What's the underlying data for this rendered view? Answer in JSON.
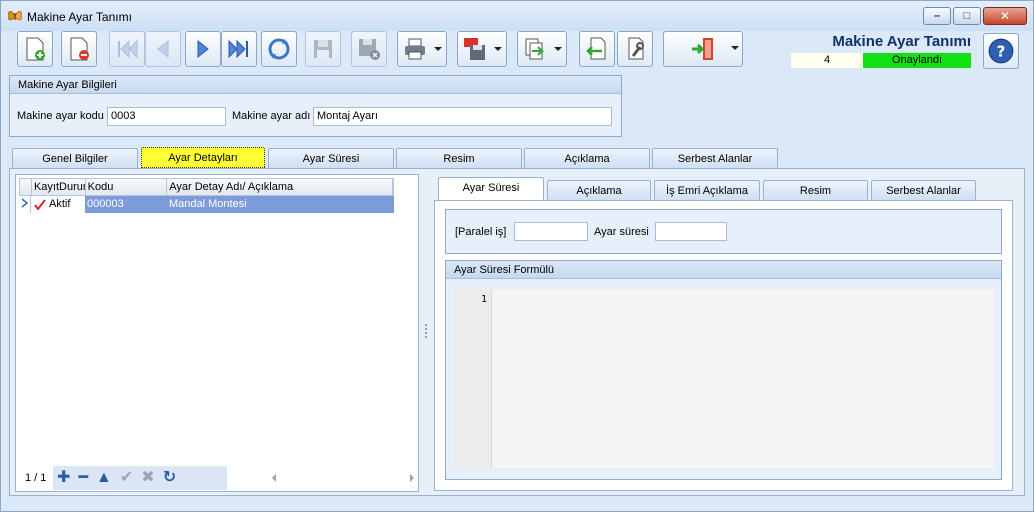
{
  "window": {
    "title": "Makine Ayar Tanımı",
    "controls": {
      "minimize": "–",
      "maximize": "□",
      "close": "✕"
    }
  },
  "header": {
    "form_title": "Makine Ayar Tanımı",
    "record_no": "4",
    "status": "Onaylandı",
    "status_color": "#12e012"
  },
  "toolbar": {
    "icons": [
      "new-document-icon",
      "delete-document-icon",
      "first-record-icon",
      "previous-record-icon",
      "next-record-icon",
      "last-record-icon",
      "refresh-icon",
      "save-icon",
      "save-cancel-icon",
      "print-icon",
      "pdf-export-icon",
      "export-icon",
      "import-icon",
      "settings-tool-icon",
      "exit-door-icon",
      "help-icon"
    ]
  },
  "info_group": {
    "title": "Makine Ayar Bilgileri",
    "code_label": "Makine ayar kodu",
    "code_value": "0003",
    "name_label": "Makine ayar adı",
    "name_value": "Montaj Ayarı"
  },
  "main_tabs": [
    "Genel Bilgiler",
    "Ayar Detayları",
    "Ayar Süresi",
    "Resim",
    "Açıklama",
    "Serbest Alanlar"
  ],
  "detail_grid": {
    "columns": [
      "KayıtDurumu",
      "Kodu",
      "Ayar Detay Adı/ Açıklama"
    ],
    "rows": [
      {
        "status": "Aktif",
        "code": "000003",
        "name": "Mandal Montesi"
      }
    ],
    "pager": "1 / 1"
  },
  "sub_tabs": [
    "Ayar Süresi",
    "Açıklama",
    "İş Emri Açıklama",
    "Resim",
    "Serbest Alanlar"
  ],
  "duration": {
    "parallel_label": "[Paralel iş]",
    "parallel_value": "",
    "duration_label": "Ayar süresi",
    "duration_value": ""
  },
  "formula": {
    "title": "Ayar Süresi Formülü",
    "line_number": "1"
  }
}
